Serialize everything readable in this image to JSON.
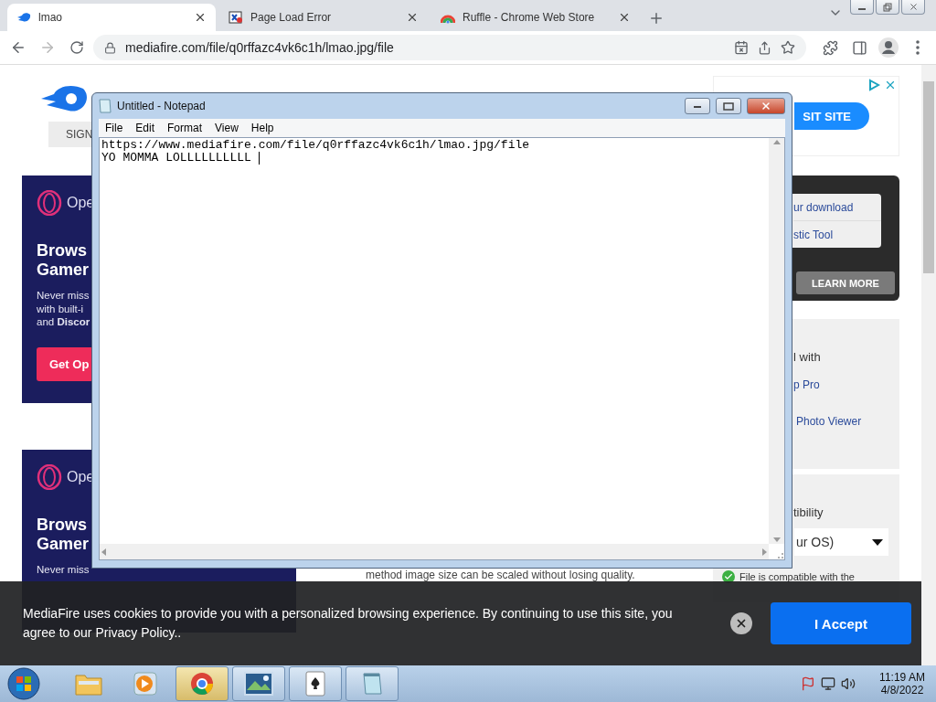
{
  "browser": {
    "tabs": [
      {
        "title": "lmao",
        "selected": true,
        "kind": "mediafire"
      },
      {
        "title": "Page Load Error",
        "selected": false,
        "kind": "error"
      },
      {
        "title": "Ruffle - Chrome Web Store",
        "selected": false,
        "kind": "store"
      }
    ],
    "nav": [
      {
        "kind": "back",
        "disabled": false
      },
      {
        "kind": "forward",
        "disabled": true
      },
      {
        "kind": "reload",
        "disabled": false
      }
    ],
    "address": "mediafire.com/file/q0rffazc4vk6c1h/lmao.jpg/file"
  },
  "page": {
    "sign_button": "SIGN",
    "ads": [
      {
        "brand": "Ope",
        "headline": "Brows\nGamer",
        "body": "Never miss\nwith built-i\nand **Discor**",
        "button": "Get Op"
      },
      {
        "brand": "Ope",
        "headline": "Brows\nGamer",
        "body": "Never miss"
      }
    ],
    "top_ad": {
      "button": "SIT SITE"
    },
    "download_card": {
      "links": [
        "ur download",
        "stic Tool"
      ],
      "button": "LEARN MORE"
    },
    "open_with": {
      "heading": "l with",
      "apps": [
        "p Pro",
        "Photo Viewer"
      ]
    },
    "compatibility": {
      "heading": "tibility",
      "select": "ur OS)",
      "note": "File is compatible with the"
    },
    "description": "method image size can be scaled without losing quality."
  },
  "notepad": {
    "title": "Untitled - Notepad",
    "menu": [
      "File",
      "Edit",
      "Format",
      "View",
      "Help"
    ],
    "lines": [
      "https://www.mediafire.com/file/q0rffazc4vk6c1h/lmao.jpg/file",
      "YO MOMMA LOLLLLLLLLLL "
    ]
  },
  "cookie_banner": {
    "text": "MediaFire uses cookies to provide you with a personalized browsing experience. By continuing to use this site, you agree to our Privacy Policy..",
    "button": "I Accept"
  },
  "taskbar": {
    "apps": [
      {
        "kind": "explorer",
        "open": false,
        "active": false
      },
      {
        "kind": "media",
        "open": false,
        "active": false
      },
      {
        "kind": "chrome",
        "open": true,
        "active": true
      },
      {
        "kind": "photos",
        "open": true,
        "active": false
      },
      {
        "kind": "solitaire",
        "open": true,
        "active": false
      },
      {
        "kind": "notepad",
        "open": true,
        "active": false
      }
    ],
    "time": "11:19 AM",
    "date": "4/8/2022"
  }
}
